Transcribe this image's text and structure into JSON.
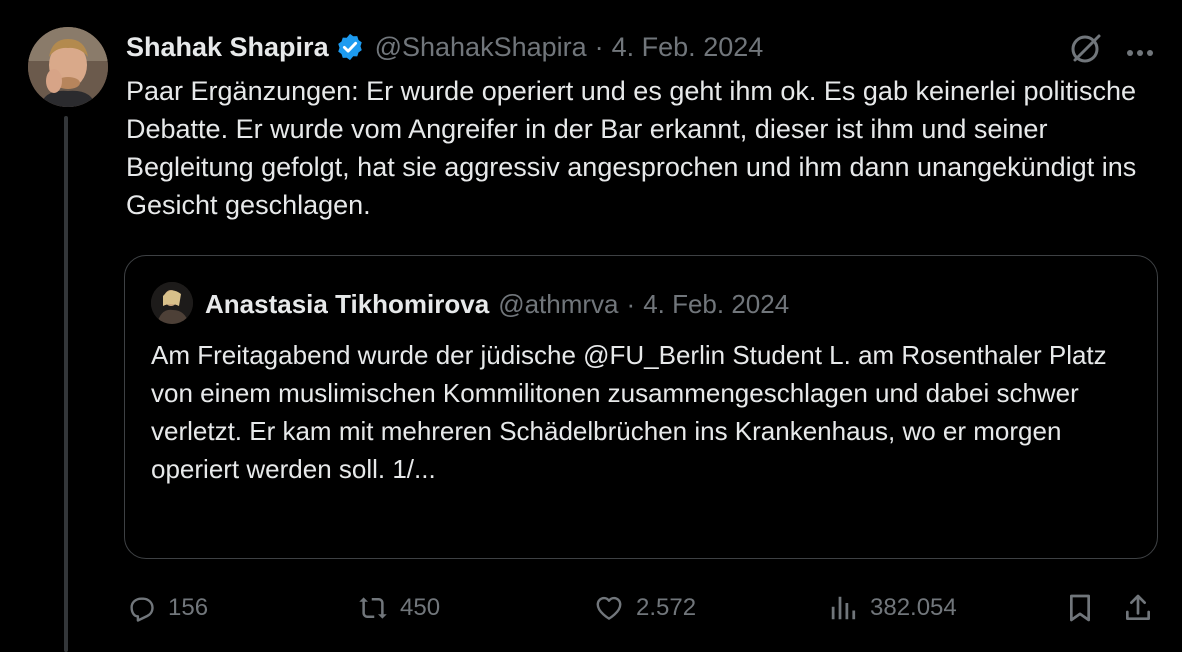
{
  "tweet": {
    "author_name": "Shahak Shapira",
    "author_handle": "@ShahakShapira",
    "separator": "·",
    "date": "4. Feb. 2024",
    "text": "Paar Ergänzungen: Er wurde operiert und es geht ihm ok. Es gab keinerlei politische Debatte. Er wurde vom Angreifer in der Bar erkannt, dieser ist ihm und seiner Begleitung gefolgt, hat sie aggressiv angesprochen und ihm dann unangekündigt ins Gesicht geschlagen."
  },
  "quote": {
    "author_name": "Anastasia Tikhomirova",
    "author_handle": "@athmrva",
    "separator": "·",
    "date": "4. Feb. 2024",
    "text": "Am Freitagabend wurde der jüdische @FU_Berlin Student L. am Rosenthaler Platz von einem muslimischen Kommilitonen zusammengeschlagen und dabei schwer verletzt. Er kam mit mehreren Schädelbrüchen ins Krankenhaus, wo er morgen operiert werden soll. 1/..."
  },
  "actions": {
    "replies": "156",
    "reposts": "450",
    "likes": "2.572",
    "views": "382.054"
  },
  "icons": {
    "verified": "verified-badge-icon",
    "grok": "grok-icon",
    "more": "more-icon",
    "reply": "reply-icon",
    "repost": "repost-icon",
    "like": "like-icon",
    "views": "views-icon",
    "bookmark": "bookmark-icon",
    "share": "share-icon"
  },
  "colors": {
    "background": "#000000",
    "text": "#e7e9ea",
    "muted": "#71767b",
    "verified": "#1d9bf0",
    "border": "#3e4144"
  }
}
